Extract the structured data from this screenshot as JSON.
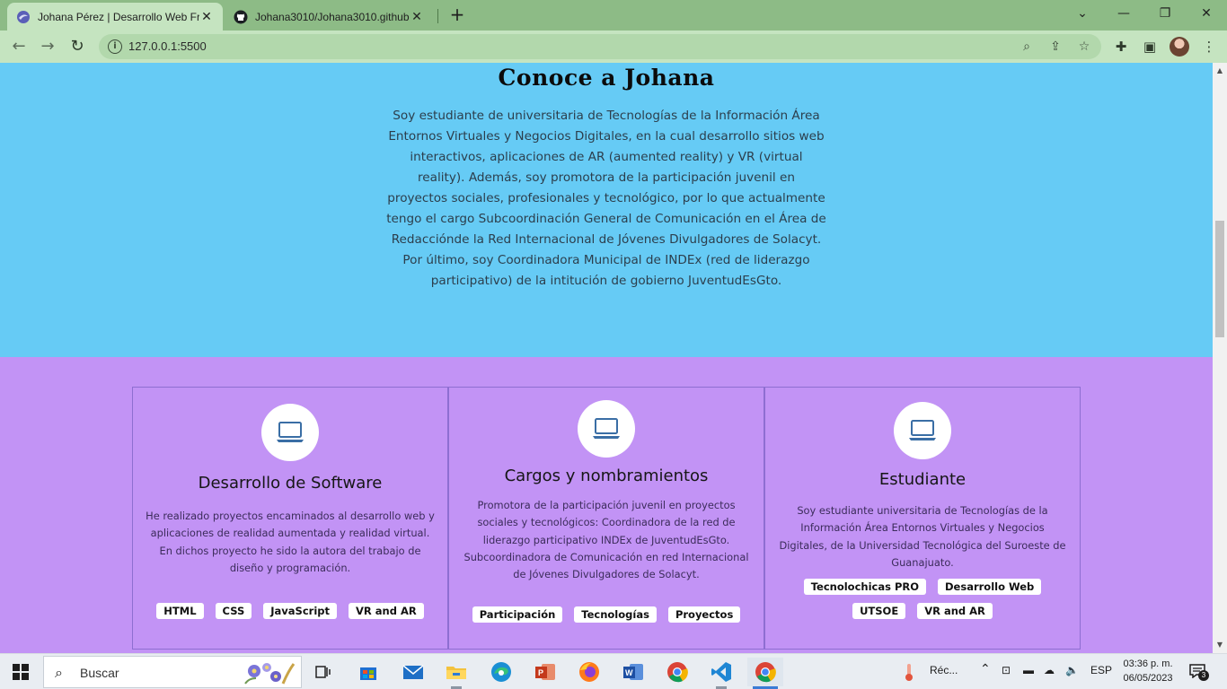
{
  "browser": {
    "tabs": [
      {
        "title": "Johana Pérez | Desarrollo Web Fr",
        "active": true,
        "icon": "site-favicon"
      },
      {
        "title": "Johana3010/Johana3010.github.i",
        "active": false,
        "icon": "github-icon"
      }
    ],
    "new_tab_symbol": "+",
    "window_controls": {
      "dropdown": "⌄",
      "minimize": "—",
      "restore": "❐",
      "close": "✕"
    },
    "url": "127.0.0.1:5500",
    "tab_close": "✕"
  },
  "about": {
    "title": "Conoce a Johana",
    "text": "Soy estudiante de universitaria de Tecnologías de la Información Área Entornos Virtuales y Negocios Digitales, en la cual desarrollo sitios web interactivos, aplicaciones de AR (aumented reality) y VR (virtual reality). Además, soy promotora de la participación juvenil en proyectos sociales, profesionales y tecnológico, por lo que actualmente tengo el cargo Subcoordinación General de Comunicación en el Área de Redacciónde la Red Internacional de Jóvenes Divulgadores de Solacyt. Por último, soy Coordinadora Municipal de INDEx (red de liderazgo participativo) de la intitución de gobierno JuventudEsGto.",
    "background_color": "#66cbf5"
  },
  "cards": [
    {
      "title": "Desarrollo de Software",
      "icon": "laptop-icon",
      "text": "He realizado proyectos encaminados al desarrollo web y aplicaciones de realidad aumentada y realidad virtual. En dichos proyecto he sido la autora del trabajo de diseño y programación.",
      "tags": [
        "HTML",
        "CSS",
        "JavaScript",
        "VR and AR"
      ]
    },
    {
      "title": "Cargos y nombramientos",
      "icon": "laptop-icon",
      "text": "Promotora de la participación juvenil en proyectos sociales y tecnológicos: Coordinadora de la red de liderazgo participativo INDEx de JuventudEsGto. Subcoordinadora de Comunicación en red Internacional de Jóvenes Divulgadores de Solacyt.",
      "tags": [
        "Participación",
        "Tecnologías",
        "Proyectos"
      ]
    },
    {
      "title": "Estudiante",
      "icon": "laptop-icon",
      "text": "Soy estudiante universitaria de Tecnologías de la Información Área Entornos Virtuales y Negocios Digitales, de la Universidad Tecnológica del Suroeste de Guanajuato.",
      "tags": [
        "Tecnolochicas PRO",
        "Desarrollo Web",
        "UTSOE",
        "VR and AR"
      ]
    }
  ],
  "cards_background_color": "#c293f5",
  "taskbar": {
    "search_placeholder": "Buscar",
    "weather_text": "Réc...",
    "language": "ESP",
    "time": "03:36 p. m.",
    "date": "06/05/2023",
    "notification_count": "3",
    "apps": [
      "task-view-icon",
      "microsoft-store-icon",
      "mail-icon",
      "file-explorer-icon",
      "edge-icon",
      "powerpoint-icon",
      "firefox-icon",
      "word-icon",
      "chrome-icon",
      "vscode-icon",
      "chrome-icon"
    ]
  }
}
